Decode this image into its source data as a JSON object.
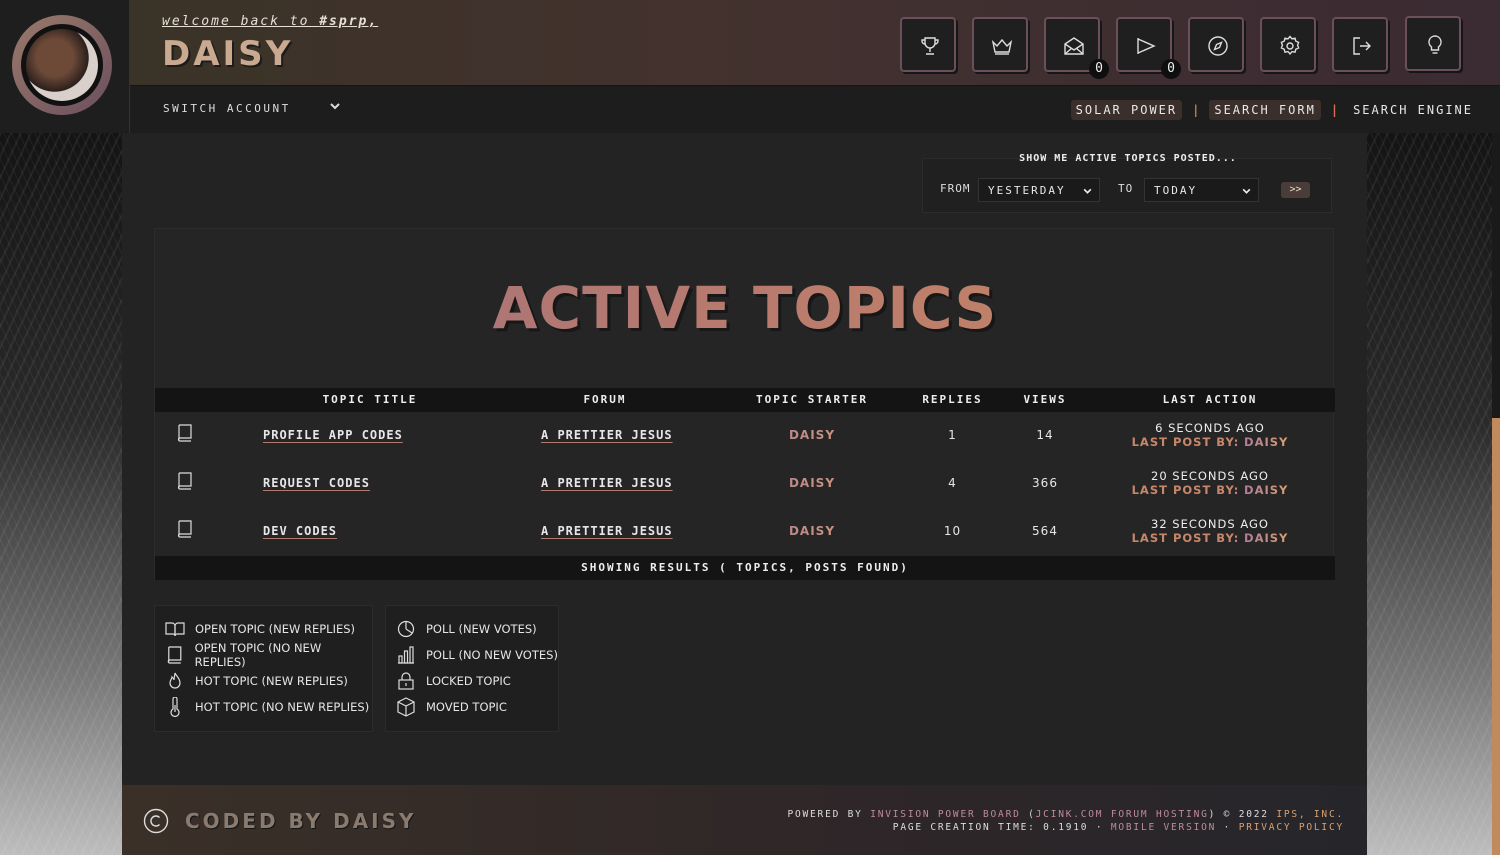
{
  "header": {
    "welcome_prefix": "welcome back to ",
    "welcome_site": "#sprp,",
    "username": "DAISY",
    "icons": [
      {
        "name": "trophy-icon"
      },
      {
        "name": "crown-icon"
      },
      {
        "name": "mail-icon",
        "badge": "0"
      },
      {
        "name": "megaphone-icon",
        "badge": "0"
      },
      {
        "name": "compass-icon"
      },
      {
        "name": "gear-icon"
      },
      {
        "name": "logout-icon"
      },
      {
        "name": "lightbulb-icon"
      }
    ],
    "switch_account": "SWITCH ACCOUNT",
    "nav": [
      "SOLAR POWER",
      "SEARCH FORM",
      "SEARCH ENGINE"
    ],
    "nav_sep": "|"
  },
  "filter": {
    "title": "SHOW ME ACTIVE TOPICS POSTED...",
    "from_label": "FROM",
    "from_value": "YESTERDAY",
    "to_label": "TO",
    "to_value": "TODAY",
    "go": ">>"
  },
  "page_title": "ACTIVE TOPICS",
  "table": {
    "headers": [
      "TOPIC TITLE",
      "FORUM",
      "TOPIC STARTER",
      "REPLIES",
      "VIEWS",
      "LAST ACTION"
    ],
    "rows": [
      {
        "title": "PROFILE APP CODES",
        "forum": "A PRETTIER JESUS",
        "starter": "DAISY",
        "replies": "1",
        "views": "14",
        "last_time": "6 SECONDS AGO",
        "last_label": "LAST POST BY:",
        "last_by": "DAISY"
      },
      {
        "title": "REQUEST CODES",
        "forum": "A PRETTIER JESUS",
        "starter": "DAISY",
        "replies": "4",
        "views": "366",
        "last_time": "20 SECONDS AGO",
        "last_label": "LAST POST BY:",
        "last_by": "DAISY"
      },
      {
        "title": "DEV CODES",
        "forum": "A PRETTIER JESUS",
        "starter": "DAISY",
        "replies": "10",
        "views": "564",
        "last_time": "32 SECONDS AGO",
        "last_label": "LAST POST BY:",
        "last_by": "DAISY"
      }
    ],
    "footer": "SHOWING RESULTS ( TOPICS, POSTS FOUND)"
  },
  "legend": {
    "left": [
      {
        "icon": "open-book-icon",
        "label": "OPEN TOPIC (NEW REPLIES)"
      },
      {
        "icon": "closed-book-icon",
        "label": "OPEN TOPIC (NO NEW REPLIES)"
      },
      {
        "icon": "flame-icon",
        "label": "HOT TOPIC (NEW REPLIES)"
      },
      {
        "icon": "thermometer-icon",
        "label": "HOT TOPIC (NO NEW REPLIES)"
      }
    ],
    "right": [
      {
        "icon": "pie-chart-icon",
        "label": "POLL (NEW VOTES)"
      },
      {
        "icon": "bar-chart-icon",
        "label": "POLL (NO NEW VOTES)"
      },
      {
        "icon": "lock-icon",
        "label": "LOCKED TOPIC"
      },
      {
        "icon": "box-icon",
        "label": "MOVED TOPIC"
      }
    ]
  },
  "footer": {
    "coded_by": "CODED BY DAISY",
    "powered_by": "POWERED BY",
    "ipb": "INVISION POWER BOARD",
    "hosting": "JCINK.COM FORUM HOSTING",
    "copyright": "© 2022",
    "ips": "IPS, INC.",
    "page_time": "PAGE CREATION TIME: 0.1910",
    "mobile": "MOBILE VERSION",
    "privacy": "PRIVACY POLICY"
  },
  "colors": {
    "accent_pink": "#b07c9a",
    "accent_orange": "#d8a070",
    "bg": "#232323"
  }
}
